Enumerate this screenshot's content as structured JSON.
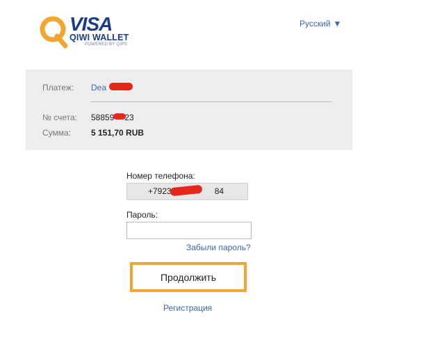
{
  "logo": {
    "brand": "VISA",
    "product": "QIWI WALLET",
    "powered": "POWERED BY QIPS"
  },
  "language": {
    "current": "Русский",
    "arrow": "▼"
  },
  "payment": {
    "payment_label": "Платеж:",
    "payment_value": "Dea",
    "account_label": "№ счета:",
    "account_value": "58859",
    "account_value_tail": "23",
    "amount_label": "Сумма:",
    "amount_value": "5 151,70 RUB"
  },
  "login": {
    "phone_label": "Номер телефона:",
    "phone_value": "+7923",
    "phone_value_tail": "84",
    "password_label": "Пароль:",
    "password_value": "",
    "forgot_link": "Забыли пароль?",
    "continue_button": "Продолжить",
    "register_link": "Регистрация"
  },
  "colors": {
    "accent": "#f3a532",
    "link": "#3a66b4",
    "brand": "#1a3b8c",
    "redaction": "#e8261c"
  }
}
